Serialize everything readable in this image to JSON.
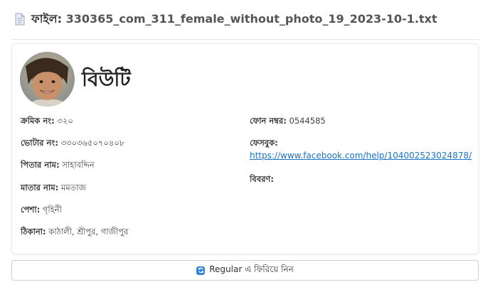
{
  "file_header": {
    "label": "ফাইল:",
    "filename": "330365_com_311_female_without_photo_19_2023-10-1.txt",
    "icon": "file-icon"
  },
  "profile": {
    "name": "বিউটি",
    "avatar": "avatar-photo",
    "fields_left": [
      {
        "label": "ক্রমিক নং:",
        "value": "৩২০"
      },
      {
        "label": "ভোটার নং:",
        "value": "৩৩০৩৬৫০৭০৪০৮"
      },
      {
        "label": "পিতার নাম:",
        "value": "সাহাবদ্দিন"
      },
      {
        "label": "মাতার নাম:",
        "value": "মমতাজ"
      },
      {
        "label": "পেশা:",
        "value": "গৃহিনী"
      },
      {
        "label": "ঠিকানা:",
        "value": "কাঠালী, শ্রীপুর, গাজীপুর"
      }
    ],
    "phone": {
      "label": "ফোন নম্বর:",
      "value": "0544585"
    },
    "facebook": {
      "label": "ফেসবুক:",
      "url": "https://www.facebook.com/help/104002523024878/"
    },
    "description": {
      "label": "বিবরণ:",
      "value": ""
    }
  },
  "restore_button": {
    "label": "Regular এ ফিরিয়ে নিন",
    "icon": "sync-icon"
  },
  "colors": {
    "link": "#1a73c8",
    "icon_blue": "#2f86d6"
  }
}
